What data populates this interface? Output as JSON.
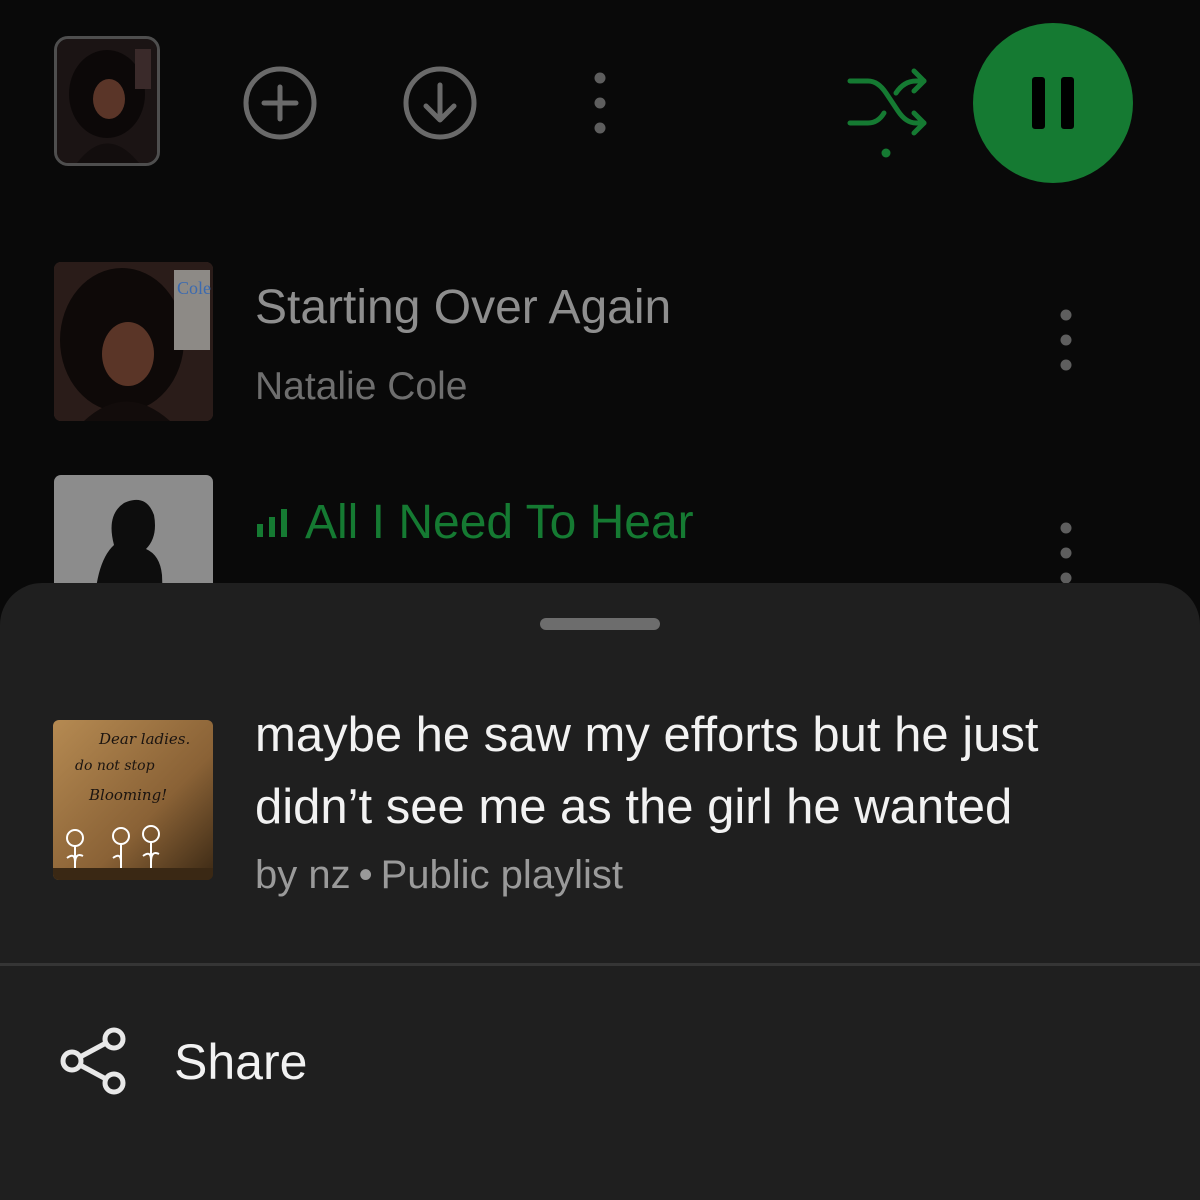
{
  "top_controls": {
    "cover_icon": "playlist-cover-image",
    "add_icon": "plus-circle-icon",
    "download_icon": "download-circle-icon",
    "more_icon": "vertical-dots-icon",
    "shuffle_icon": "shuffle-icon",
    "pause_icon": "pause-icon",
    "accent_color": "#157a32"
  },
  "tracks": [
    {
      "title": "Starting Over Again",
      "artist": "Natalie Cole",
      "playing": false
    },
    {
      "title": "All I Need To Hear",
      "artist": "",
      "playing": true
    }
  ],
  "sheet": {
    "playlist_title": "maybe he saw my efforts but he just didn’t see me as the girl he wanted",
    "meta_owner": "by nz",
    "meta_separator": "•",
    "meta_type": "Public playlist",
    "cover_text": [
      "Dear ladies.",
      "do not stop",
      "Blooming!"
    ],
    "actions": [
      {
        "label": "Share",
        "icon": "share-icon"
      }
    ]
  }
}
